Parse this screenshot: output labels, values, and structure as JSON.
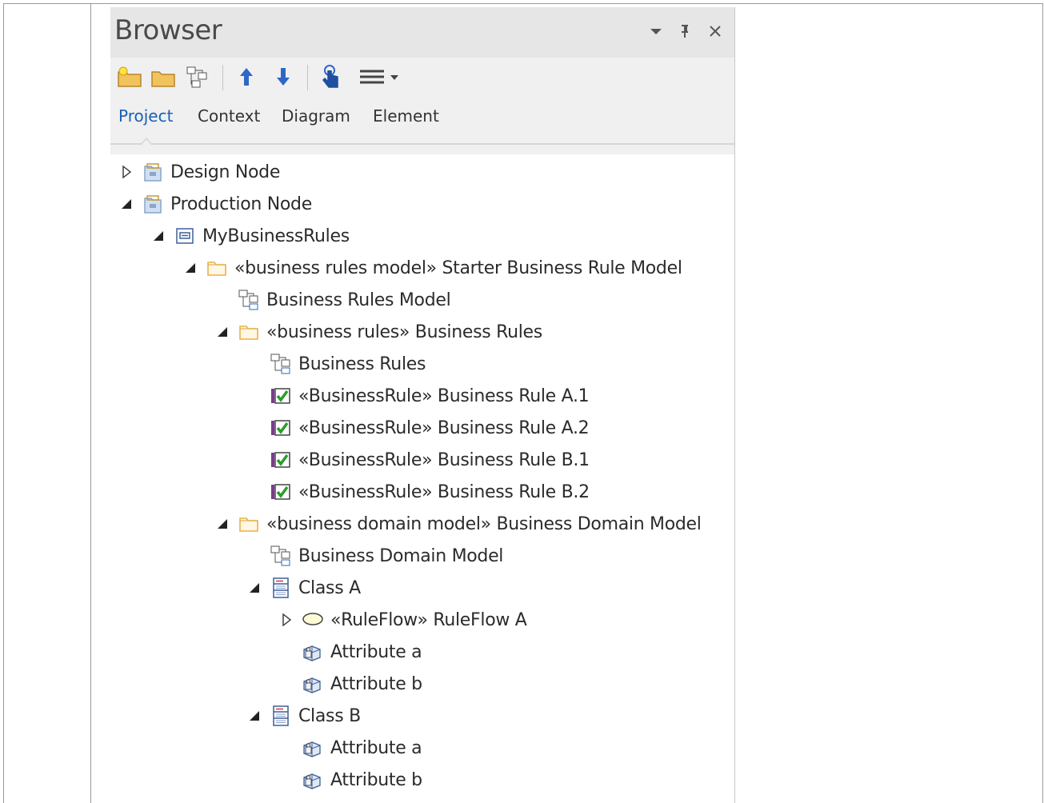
{
  "panel": {
    "title": "Browser",
    "controls": {
      "dropdown": "▾",
      "pin": "ꟻ",
      "close": "✕"
    }
  },
  "toolbar": {
    "buttons": [
      {
        "name": "new-package-icon"
      },
      {
        "name": "open-folder-icon"
      },
      {
        "name": "new-diagram-icon"
      },
      {
        "name": "move-up-icon"
      },
      {
        "name": "move-down-icon"
      },
      {
        "name": "touch-hand-icon"
      },
      {
        "name": "menu-icon"
      }
    ]
  },
  "tabs": [
    "Project",
    "Context",
    "Diagram",
    "Element"
  ],
  "active_tab": "Project",
  "tree": [
    {
      "label": "Design Node",
      "toggle": "collapsed",
      "icon": "package-node-icon",
      "level": 0
    },
    {
      "label": "Production Node",
      "toggle": "expanded",
      "icon": "package-node-icon",
      "level": 0
    },
    {
      "label": "MyBusinessRules",
      "toggle": "expanded",
      "icon": "model-package-icon",
      "level": 1
    },
    {
      "label": "«business rules model» Starter Business Rule Model",
      "toggle": "expanded",
      "icon": "folder-icon",
      "level": 2
    },
    {
      "label": "Business Rules Model",
      "toggle": "none",
      "icon": "diagram-icon",
      "level": 3
    },
    {
      "label": "«business rules» Business Rules",
      "toggle": "expanded",
      "icon": "folder-icon",
      "level": 3
    },
    {
      "label": "Business Rules",
      "toggle": "none",
      "icon": "diagram-icon",
      "level": 4
    },
    {
      "label": "«BusinessRule» Business Rule A.1",
      "toggle": "none",
      "icon": "business-rule-icon",
      "level": 4
    },
    {
      "label": "«BusinessRule» Business Rule A.2",
      "toggle": "none",
      "icon": "business-rule-icon",
      "level": 4
    },
    {
      "label": "«BusinessRule» Business Rule B.1",
      "toggle": "none",
      "icon": "business-rule-icon",
      "level": 4
    },
    {
      "label": "«BusinessRule» Business Rule B.2",
      "toggle": "none",
      "icon": "business-rule-icon",
      "level": 4
    },
    {
      "label": "«business domain model» Business Domain Model",
      "toggle": "expanded",
      "icon": "folder-icon",
      "level": 3
    },
    {
      "label": "Business Domain Model",
      "toggle": "none",
      "icon": "diagram-icon",
      "level": 4
    },
    {
      "label": "Class A",
      "toggle": "expanded",
      "icon": "class-icon",
      "level": 4
    },
    {
      "label": "«RuleFlow» RuleFlow A",
      "toggle": "collapsed",
      "icon": "activity-icon",
      "level": 5
    },
    {
      "label": "Attribute a",
      "toggle": "none",
      "icon": "attribute-icon",
      "level": 5
    },
    {
      "label": "Attribute b",
      "toggle": "none",
      "icon": "attribute-icon",
      "level": 5
    },
    {
      "label": "Class B",
      "toggle": "expanded",
      "icon": "class-icon",
      "level": 4
    },
    {
      "label": "Attribute a",
      "toggle": "none",
      "icon": "attribute-icon",
      "level": 5
    },
    {
      "label": "Attribute b",
      "toggle": "none",
      "icon": "attribute-icon",
      "level": 5
    }
  ],
  "colors": {
    "accent": "#1a5fb4",
    "toolbar_arrow": "#2f67c7",
    "package_icon": "#8aa6c8",
    "folder_icon": "#e6b24c",
    "rule_check": "#2a9d2a",
    "rule_box": "#7b3a8c"
  }
}
